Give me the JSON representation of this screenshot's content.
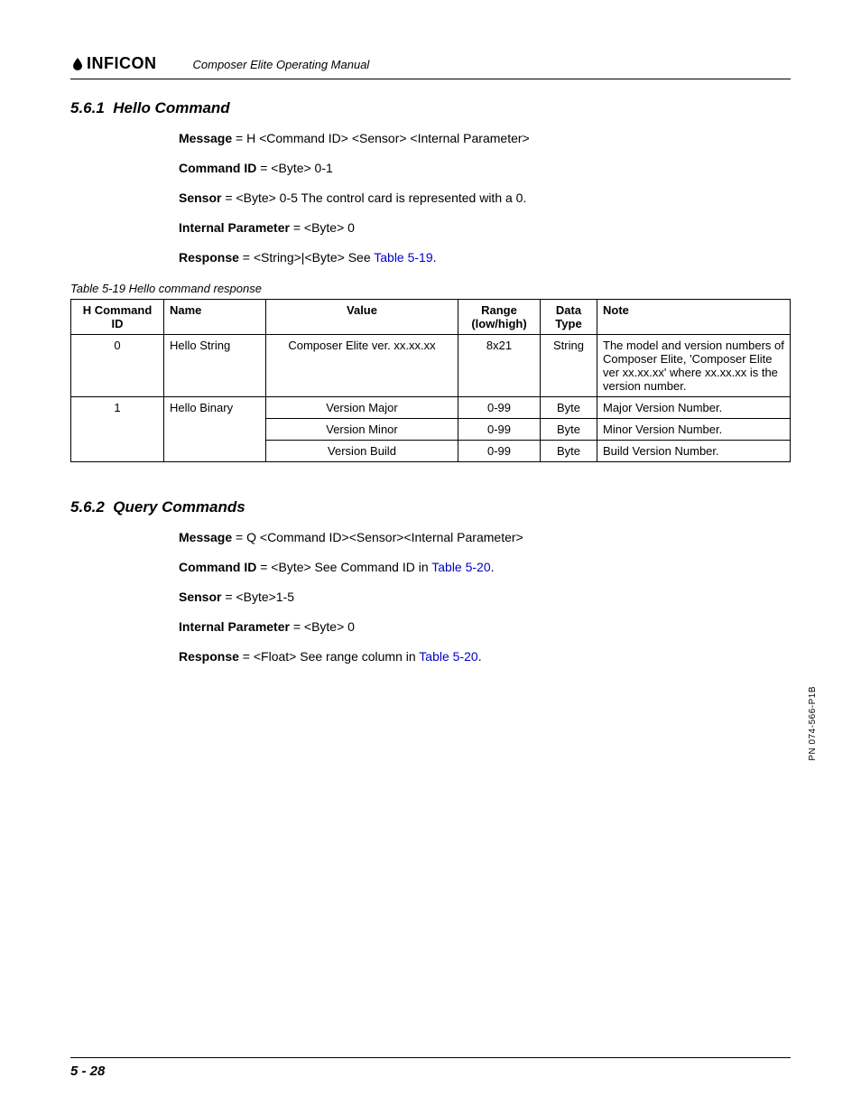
{
  "header": {
    "brand": "INFICON",
    "manual": "Composer Elite Operating Manual"
  },
  "sections": {
    "s1": {
      "num": "5.6.1",
      "title": "Hello Command",
      "defs": {
        "message_label": "Message",
        "message_val": " = H <Command ID> <Sensor> <Internal Parameter>",
        "cmdid_label": "Command ID",
        "cmdid_val": " = <Byte> 0-1",
        "sensor_label": "Sensor",
        "sensor_val": " = <Byte> 0-5 The control card is represented with a 0.",
        "ip_label": "Internal Parameter",
        "ip_val": " = <Byte> 0",
        "resp_label": "Response",
        "resp_val_pre": " = <String>|<Byte> See ",
        "resp_link": "Table 5-19",
        "resp_val_post": "."
      },
      "table_caption": "Table 5-19  Hello command response",
      "table": {
        "headers": [
          "H Command ID",
          "Name",
          "Value",
          "Range (low/high)",
          "Data Type",
          "Note"
        ],
        "rows": [
          {
            "id": "0",
            "name": "Hello String",
            "value": "Composer Elite ver. xx.xx.xx",
            "range": "8x21",
            "dtype": "String",
            "note": "The model and version numbers of Composer Elite, 'Composer Elite ver xx.xx.xx' where xx.xx.xx is the version number."
          },
          {
            "id": "1",
            "name": "Hello Binary",
            "value": "Version Major",
            "range": "0-99",
            "dtype": "Byte",
            "note": "Major Version Number."
          },
          {
            "id": "",
            "name": "",
            "value": "Version Minor",
            "range": "0-99",
            "dtype": "Byte",
            "note": "Minor Version Number."
          },
          {
            "id": "",
            "name": "",
            "value": "Version Build",
            "range": "0-99",
            "dtype": "Byte",
            "note": "Build Version Number."
          }
        ]
      }
    },
    "s2": {
      "num": "5.6.2",
      "title": "Query Commands",
      "defs": {
        "message_label": "Message",
        "message_val": " = Q <Command ID><Sensor><Internal Parameter>",
        "cmdid_label": "Command ID",
        "cmdid_val_pre": " = <Byte> See Command ID in ",
        "cmdid_link": "Table 5-20",
        "cmdid_val_post": ".",
        "sensor_label": "Sensor",
        "sensor_val": " = <Byte>1-5",
        "ip_label": "Internal Parameter",
        "ip_val": " = <Byte> 0",
        "resp_label": "Response",
        "resp_val_pre": " = <Float> See range column in ",
        "resp_link": "Table 5-20",
        "resp_val_post": "."
      }
    }
  },
  "footer": {
    "page": "5 - 28"
  },
  "side_pn": "PN 074-566-P1B"
}
